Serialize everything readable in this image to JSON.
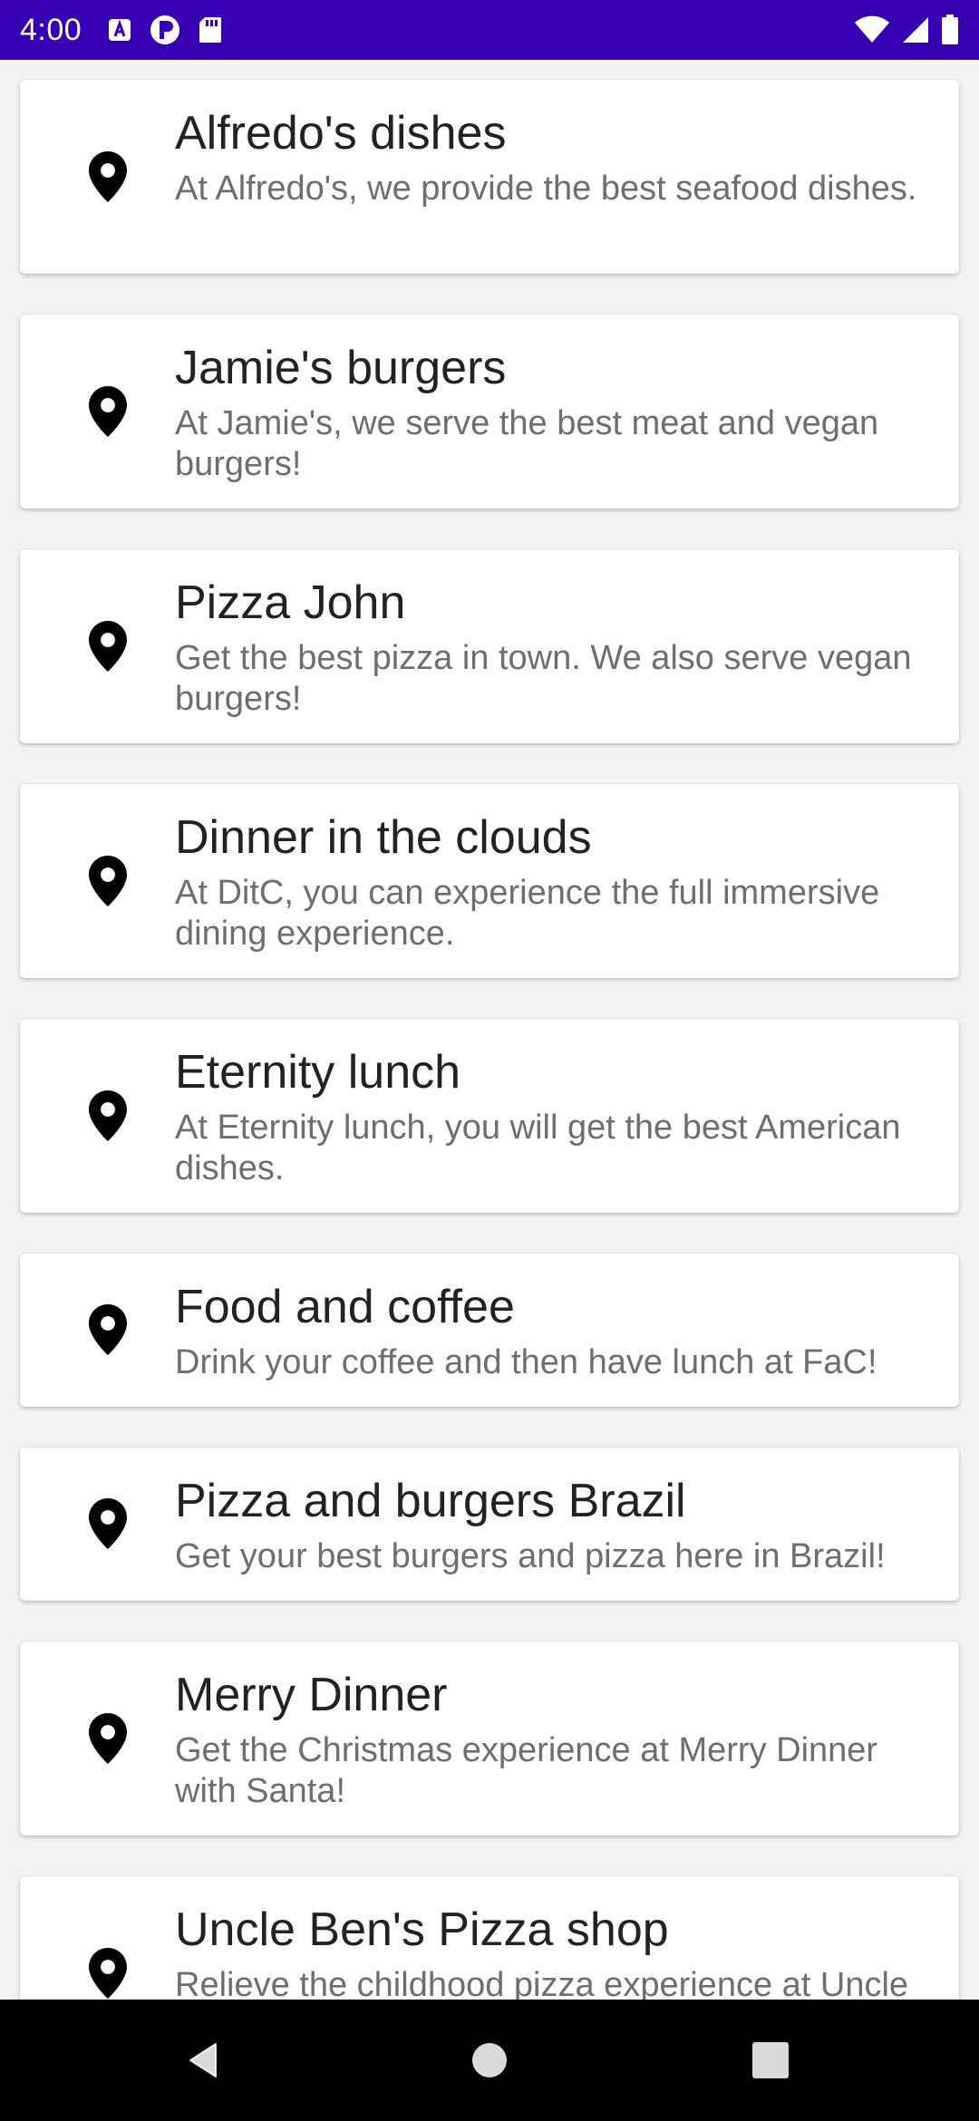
{
  "status_bar": {
    "time": "4:00",
    "background": "#3700b3",
    "left_icons": [
      "text-a-notification-icon",
      "font-p-notification-icon",
      "sd-card-icon"
    ],
    "right_icons": [
      "wifi-icon",
      "cellular-signal-icon",
      "battery-icon"
    ]
  },
  "restaurants": [
    {
      "name": "Alfredo's dishes",
      "description": "At Alfredo's, we provide the best seafood dishes.",
      "icon": "location-pin-icon"
    },
    {
      "name": "Jamie's burgers",
      "description": "At Jamie's, we serve the best meat and vegan burgers!",
      "icon": "location-pin-icon"
    },
    {
      "name": "Pizza John",
      "description": "Get the best pizza in town. We also serve vegan burgers!",
      "icon": "location-pin-icon"
    },
    {
      "name": "Dinner in the clouds",
      "description": "At DitC, you can experience the full immersive dining experience.",
      "icon": "location-pin-icon"
    },
    {
      "name": "Eternity lunch",
      "description": "At Eternity lunch, you will get the best American dishes.",
      "icon": "location-pin-icon"
    },
    {
      "name": "Food and coffee",
      "description": "Drink your coffee and then have lunch at FaC!",
      "icon": "location-pin-icon"
    },
    {
      "name": "Pizza and burgers Brazil",
      "description": "Get your best burgers and pizza here in Brazil!",
      "icon": "location-pin-icon"
    },
    {
      "name": "Merry Dinner",
      "description": "Get the Christmas experience at Merry Dinner with Santa!",
      "icon": "location-pin-icon"
    },
    {
      "name": "Uncle Ben's Pizza shop",
      "description": "Relieve the childhood pizza experience at Uncle",
      "icon": "location-pin-icon"
    }
  ],
  "nav_bar": {
    "buttons": [
      "back-triangle-icon",
      "home-circle-icon",
      "recents-square-icon"
    ]
  }
}
